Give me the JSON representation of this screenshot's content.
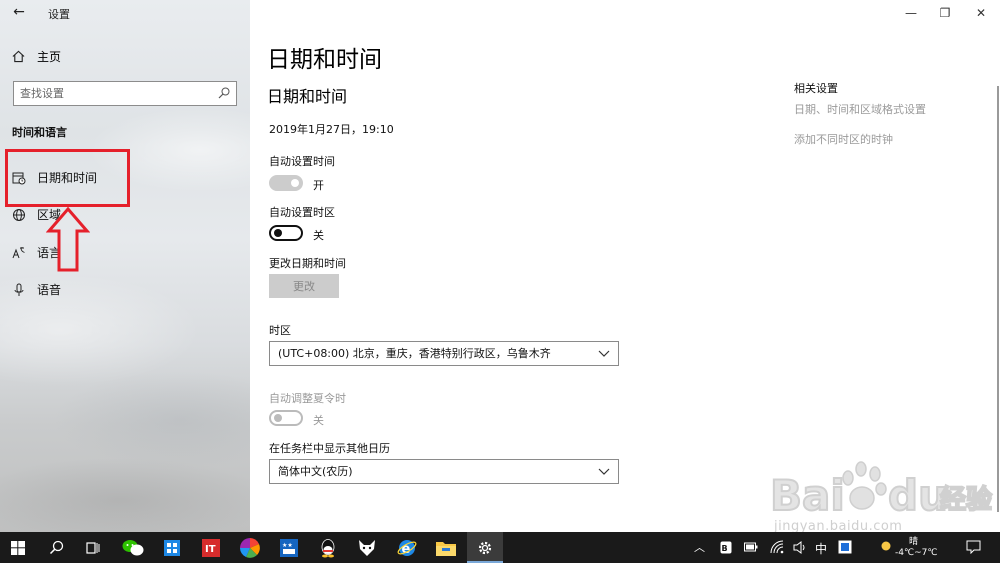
{
  "window": {
    "title": "设置",
    "back_icon": "back-arrow-icon",
    "controls": {
      "minimize": "—",
      "restore": "❐",
      "close": "✕"
    }
  },
  "sidebar": {
    "home_label": "主页",
    "search_placeholder": "查找设置",
    "section_label": "时间和语言",
    "items": [
      {
        "label": "日期和时间",
        "icon": "calendar-clock-icon"
      },
      {
        "label": "区域",
        "icon": "globe-icon"
      },
      {
        "label": "语言",
        "icon": "language-icon"
      },
      {
        "label": "语音",
        "icon": "microphone-icon"
      }
    ]
  },
  "main": {
    "page_title": "日期和时间",
    "section_title": "日期和时间",
    "current_datetime": "2019年1月27日，19:10",
    "auto_time": {
      "label": "自动设置时间",
      "state_text": "开",
      "on": true
    },
    "auto_timezone": {
      "label": "自动设置时区",
      "state_text": "关",
      "on": false
    },
    "change_datetime": {
      "label": "更改日期和时间",
      "button": "更改"
    },
    "timezone": {
      "label": "时区",
      "value": "(UTC+08:00) 北京，重庆，香港特别行政区，乌鲁木齐"
    },
    "dst": {
      "label": "自动调整夏令时",
      "state_text": "关",
      "on": false
    },
    "calendar": {
      "label": "在任务栏中显示其他日历",
      "value": "简体中文(农历)"
    }
  },
  "related": {
    "title": "相关设置",
    "links": [
      "日期、时间和区域格式设置",
      "添加不同时区的时钟"
    ]
  },
  "watermark": {
    "text": "jingyan.baidu.com",
    "logo": "Bai du 经验"
  },
  "taskbar": {
    "apps": [
      "start-icon",
      "search-icon",
      "task-view-icon",
      "wechat-icon",
      "app-icon",
      "it-app-icon",
      "color-wheel-icon",
      "news-app-icon",
      "qq-icon",
      "fox-app-icon",
      "ie-icon",
      "file-explorer-icon",
      "settings-icon"
    ],
    "tray": {
      "ime": "中",
      "weather_label": "晴",
      "weather_temp": "-4℃~7℃"
    }
  },
  "colors": {
    "highlight_red": "#e5202b",
    "taskbar_bg": "#1a1a1a"
  }
}
